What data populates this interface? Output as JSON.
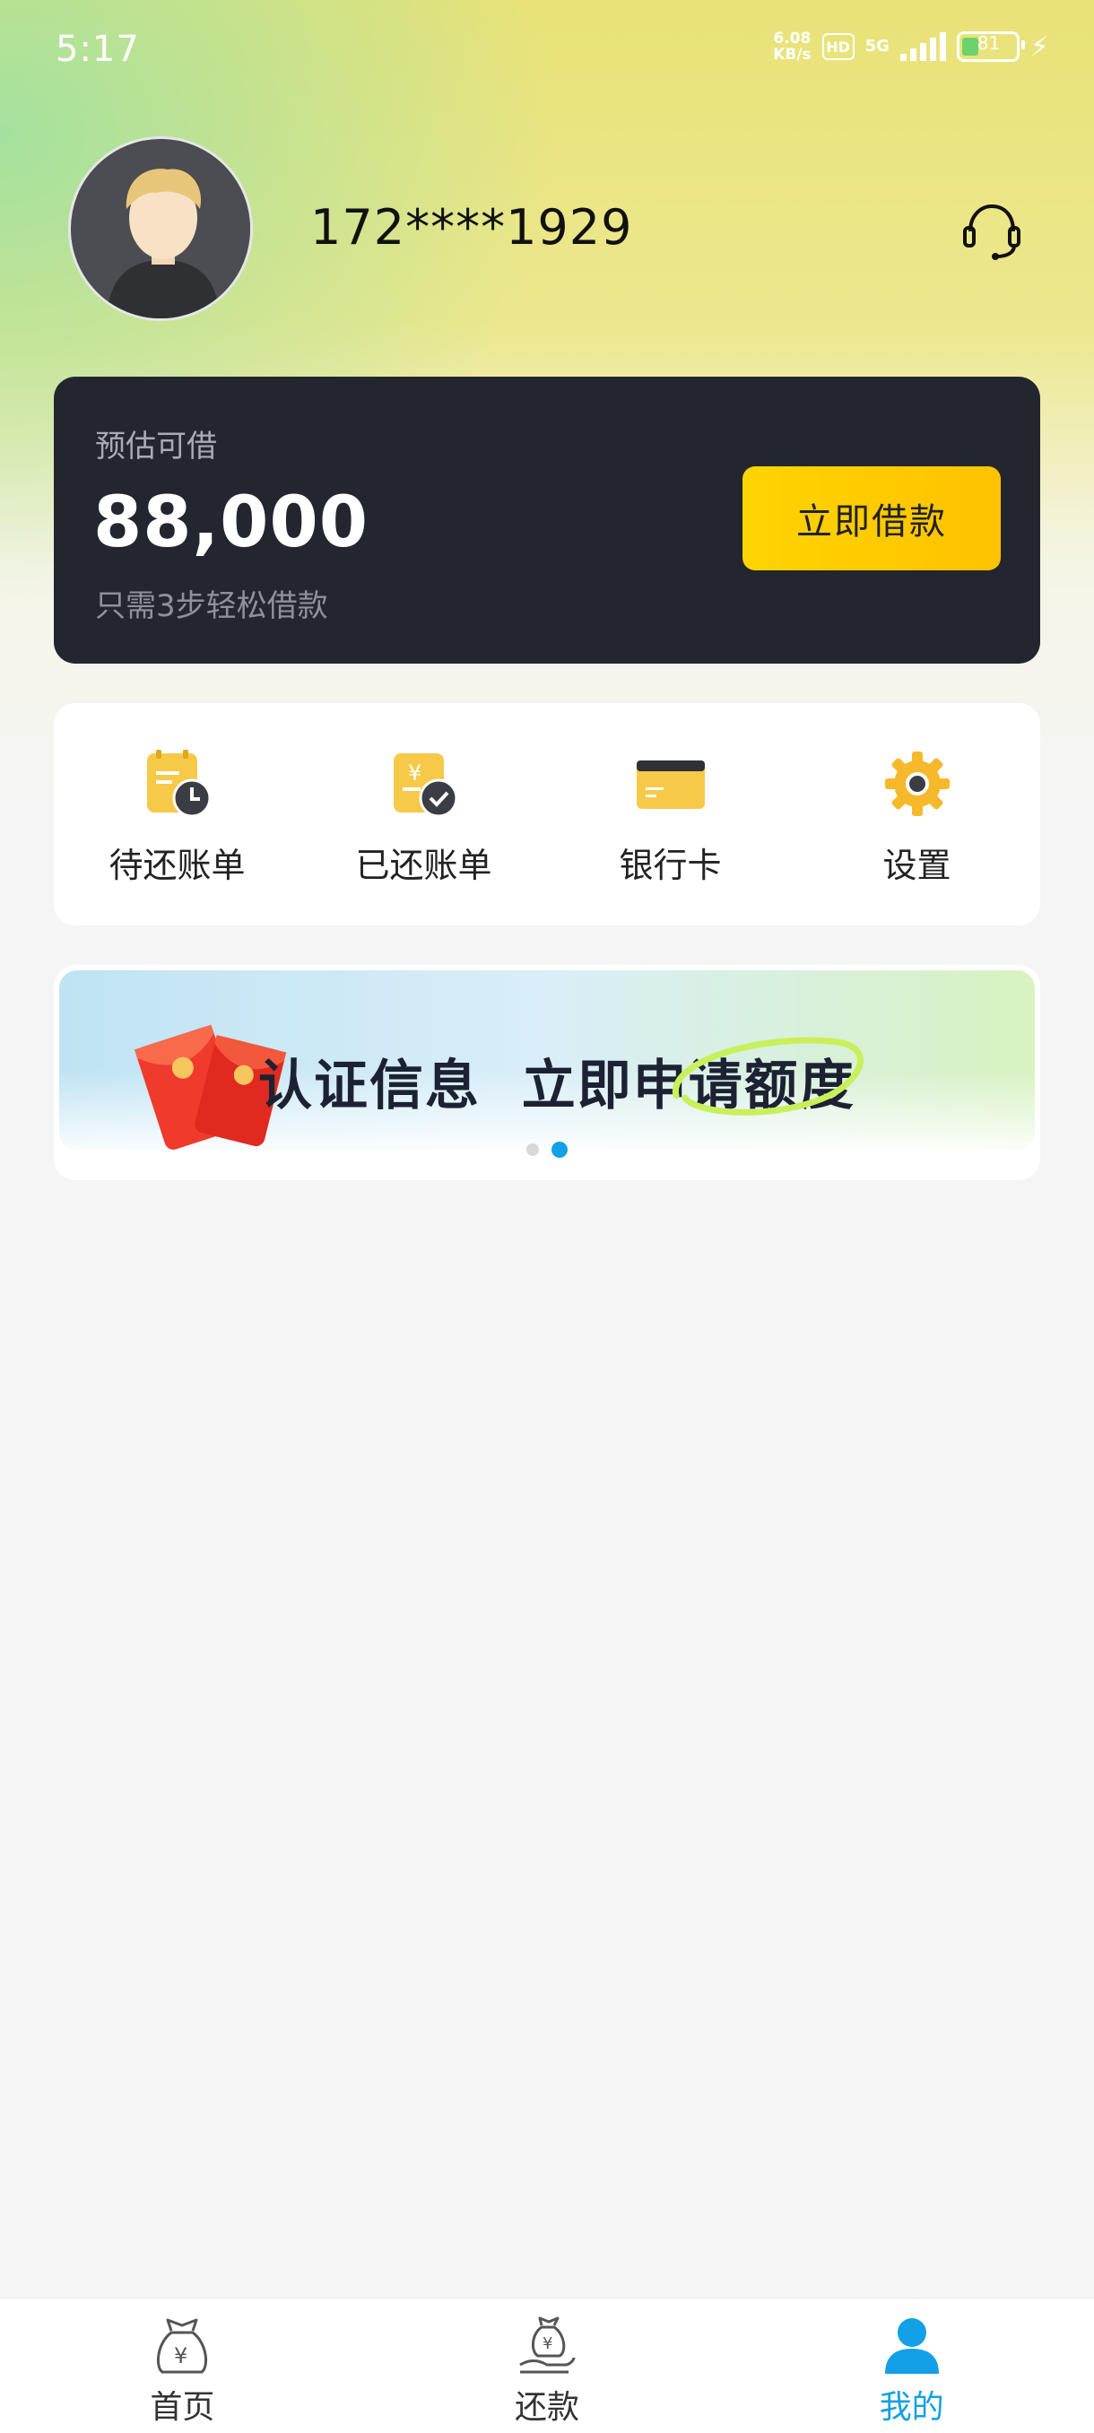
{
  "status_bar": {
    "time": "5:17",
    "net_speed": "6.08",
    "net_unit": "KB/s",
    "hd": "HD",
    "network": "5G",
    "battery": "81"
  },
  "profile": {
    "phone": "172****1929"
  },
  "loan": {
    "label": "预估可借",
    "amount": "88,000",
    "subtitle": "只需3步轻松借款",
    "button": "立即借款"
  },
  "menu": [
    {
      "label": "待还账单",
      "icon": "pending-bill-icon"
    },
    {
      "label": "已还账单",
      "icon": "paid-bill-icon"
    },
    {
      "label": "银行卡",
      "icon": "bank-card-icon"
    },
    {
      "label": "设置",
      "icon": "gear-icon"
    }
  ],
  "banner": {
    "text": "认证信息  立即申请额度",
    "page_count": 2,
    "active_page": 2
  },
  "bottom_nav": [
    {
      "label": "首页",
      "icon": "money-bag-icon"
    },
    {
      "label": "还款",
      "icon": "repay-hand-icon"
    },
    {
      "label": "我的",
      "icon": "user-icon",
      "active": true
    }
  ],
  "colors": {
    "accent": "#12a0e6",
    "loan_card_bg": "#23262f",
    "loan_button": "#ffc800"
  }
}
